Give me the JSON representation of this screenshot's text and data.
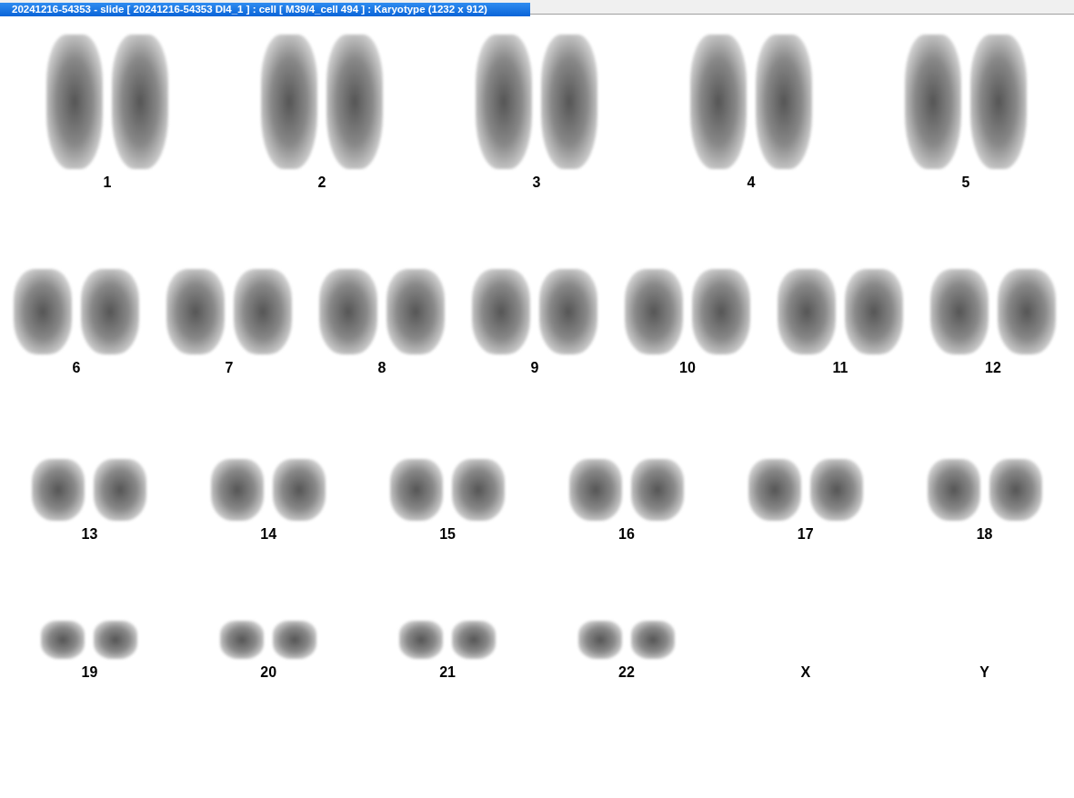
{
  "window": {
    "title": "20241216-54353 - slide [ 20241216-54353 DI4_1 ] : cell [ M39/4_cell 494 ] : Karyotype  (1232 x 912)"
  },
  "rows": [
    {
      "chromosomes": [
        {
          "label": "1",
          "has_image": true
        },
        {
          "label": "2",
          "has_image": true
        },
        {
          "label": "3",
          "has_image": true
        },
        {
          "label": "4",
          "has_image": true
        },
        {
          "label": "5",
          "has_image": true
        }
      ]
    },
    {
      "chromosomes": [
        {
          "label": "6",
          "has_image": true
        },
        {
          "label": "7",
          "has_image": true
        },
        {
          "label": "8",
          "has_image": true
        },
        {
          "label": "9",
          "has_image": true
        },
        {
          "label": "10",
          "has_image": true
        },
        {
          "label": "11",
          "has_image": true
        },
        {
          "label": "12",
          "has_image": true
        }
      ]
    },
    {
      "chromosomes": [
        {
          "label": "13",
          "has_image": true
        },
        {
          "label": "14",
          "has_image": true
        },
        {
          "label": "15",
          "has_image": true
        },
        {
          "label": "16",
          "has_image": true
        },
        {
          "label": "17",
          "has_image": true
        },
        {
          "label": "18",
          "has_image": true
        }
      ]
    },
    {
      "chromosomes": [
        {
          "label": "19",
          "has_image": true
        },
        {
          "label": "20",
          "has_image": true
        },
        {
          "label": "21",
          "has_image": true
        },
        {
          "label": "22",
          "has_image": true
        },
        {
          "label": "X",
          "has_image": false
        },
        {
          "label": "Y",
          "has_image": false
        }
      ]
    }
  ]
}
